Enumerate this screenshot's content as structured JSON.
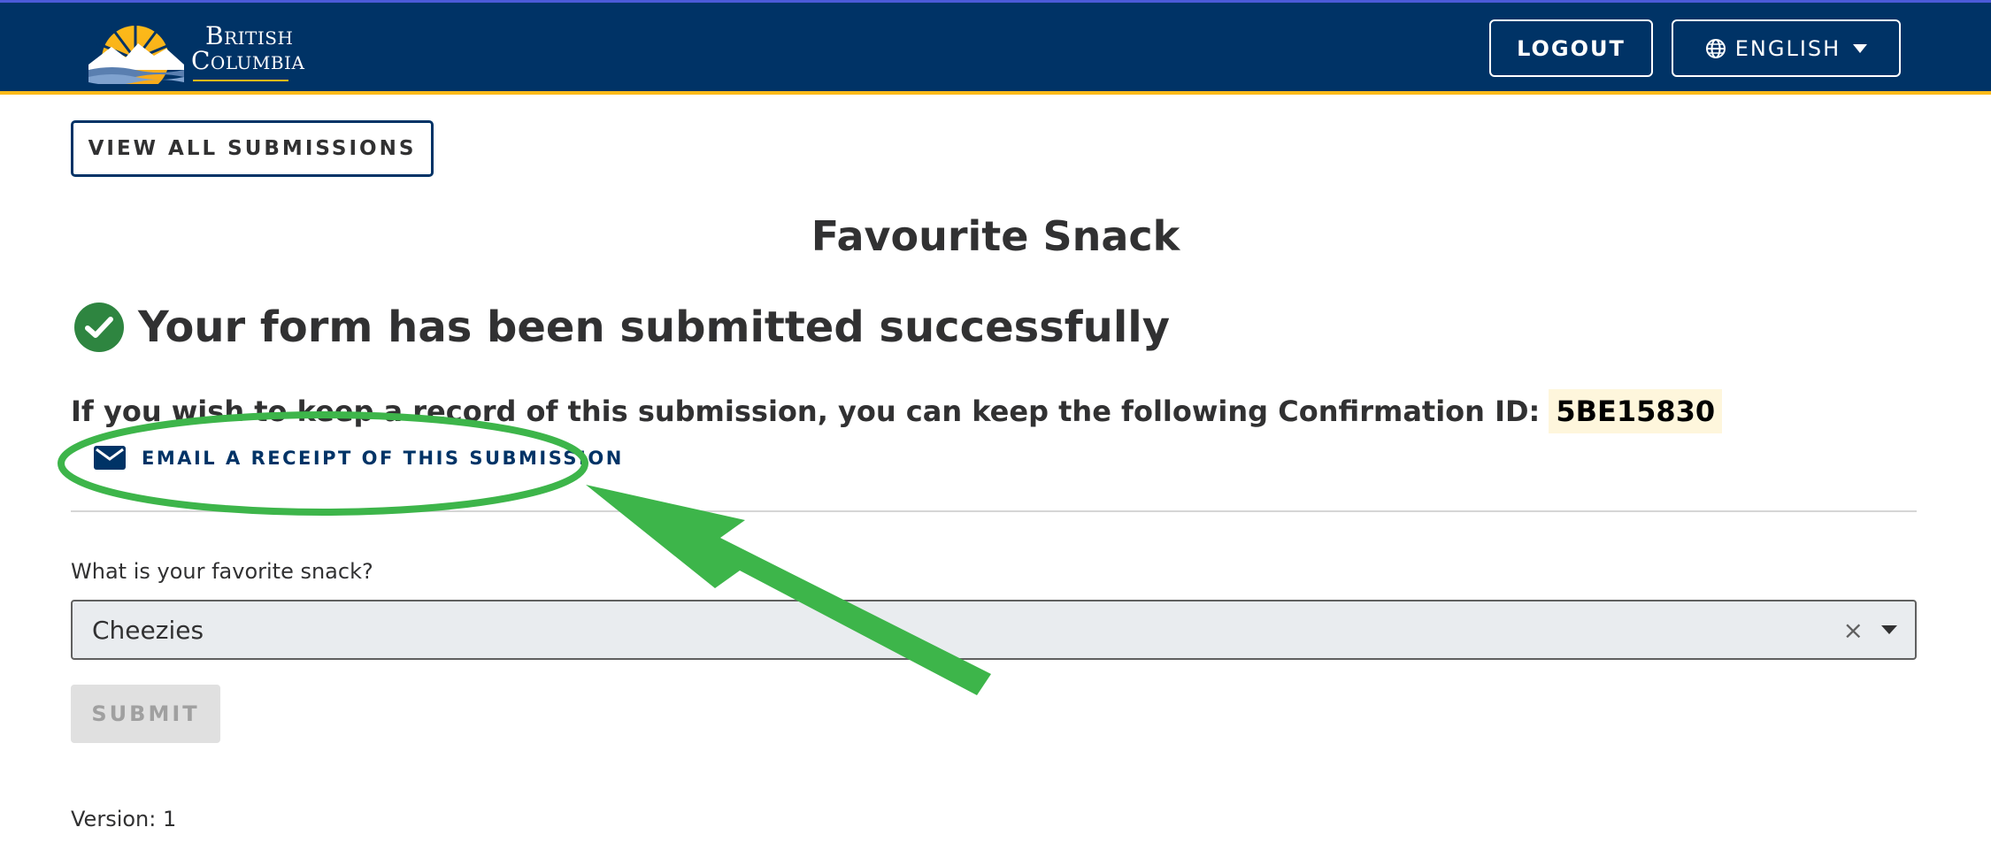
{
  "header": {
    "logo_line1": "British",
    "logo_line2": "Columbia",
    "logout_label": "LOGOUT",
    "language_label": "ENGLISH",
    "globe_icon": "globe-icon",
    "caret_icon": "caret-down-icon"
  },
  "nav": {
    "view_all_label": "VIEW ALL SUBMISSIONS"
  },
  "form": {
    "title": "Favourite Snack",
    "success_message": "Your form has been submitted successfully",
    "confirmation_text": "If you wish to keep a record of this submission, you can keep the following Confirmation ID:",
    "confirmation_id": "5BE15830",
    "email_receipt_label": "EMAIL A RECEIPT OF THIS SUBMISSION",
    "question_label": "What is your favorite snack?",
    "selected_value": "Cheezies",
    "clear_symbol": "×",
    "submit_label": "SUBMIT",
    "version_text": "Version: 1"
  },
  "colors": {
    "header_bg": "#003366",
    "header_accent": "#fcba19",
    "success_green": "#2e8540",
    "annotation_green": "#3db54a"
  }
}
